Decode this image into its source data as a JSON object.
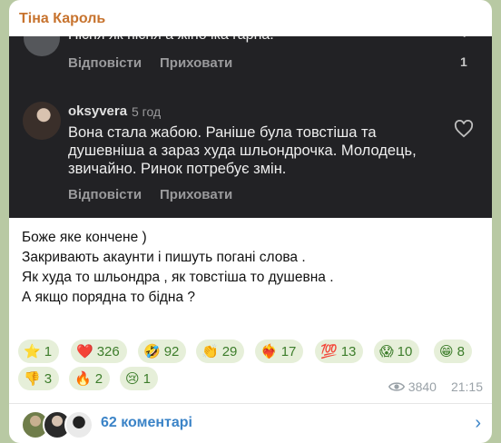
{
  "channel": {
    "name": "Тіна Кароль"
  },
  "screenshot": {
    "comment1": {
      "text": "Пісня як пісня а жіночка гарна.",
      "reply": "Відповісти",
      "hide": "Приховати",
      "likes": "1"
    },
    "comment2": {
      "user": "oksyvera",
      "time": "5 год",
      "text": "Вона стала жабою. Раніше була товстіша та душевніша а зараз худа шльондрочка. Молодець, звичайно. Ринок потребує змін.",
      "reply": "Відповісти",
      "hide": "Приховати"
    }
  },
  "post": {
    "lines": [
      "Боже яке кончене )",
      "Закривають акаунти і пишуть погані слова .",
      "Як худа то шльондра , як товстіша то душевна .",
      "А якщо порядна то бідна ?"
    ]
  },
  "reactions": [
    {
      "emoji": "⭐",
      "count": "1",
      "icon": "star-icon"
    },
    {
      "emoji": "❤️",
      "count": "326",
      "icon": "heart-icon"
    },
    {
      "emoji": "🤣",
      "count": "92",
      "icon": "rofl-icon"
    },
    {
      "emoji": "👏",
      "count": "29",
      "icon": "clap-icon"
    },
    {
      "emoji": "❤️‍🔥",
      "count": "17",
      "icon": "heart-on-fire-icon"
    },
    {
      "emoji": "💯",
      "count": "13",
      "icon": "hundred-icon"
    },
    {
      "emoji": "😱",
      "count": "10",
      "icon": "scream-icon"
    },
    {
      "emoji": "😁",
      "count": "8",
      "icon": "grin-icon"
    },
    {
      "emoji": "👎",
      "count": "3",
      "icon": "thumbs-down-icon"
    },
    {
      "emoji": "🔥",
      "count": "2",
      "icon": "fire-icon"
    },
    {
      "emoji": "😢",
      "count": "1",
      "icon": "cry-icon"
    }
  ],
  "meta": {
    "views": "3840",
    "time": "21:15"
  },
  "footer": {
    "comments": "62 коментарі"
  },
  "colors": {
    "channel": "#c7732e",
    "link": "#3a83c7",
    "chip_bg": "#e6efd9",
    "chip_text": "#3d7d2b"
  }
}
